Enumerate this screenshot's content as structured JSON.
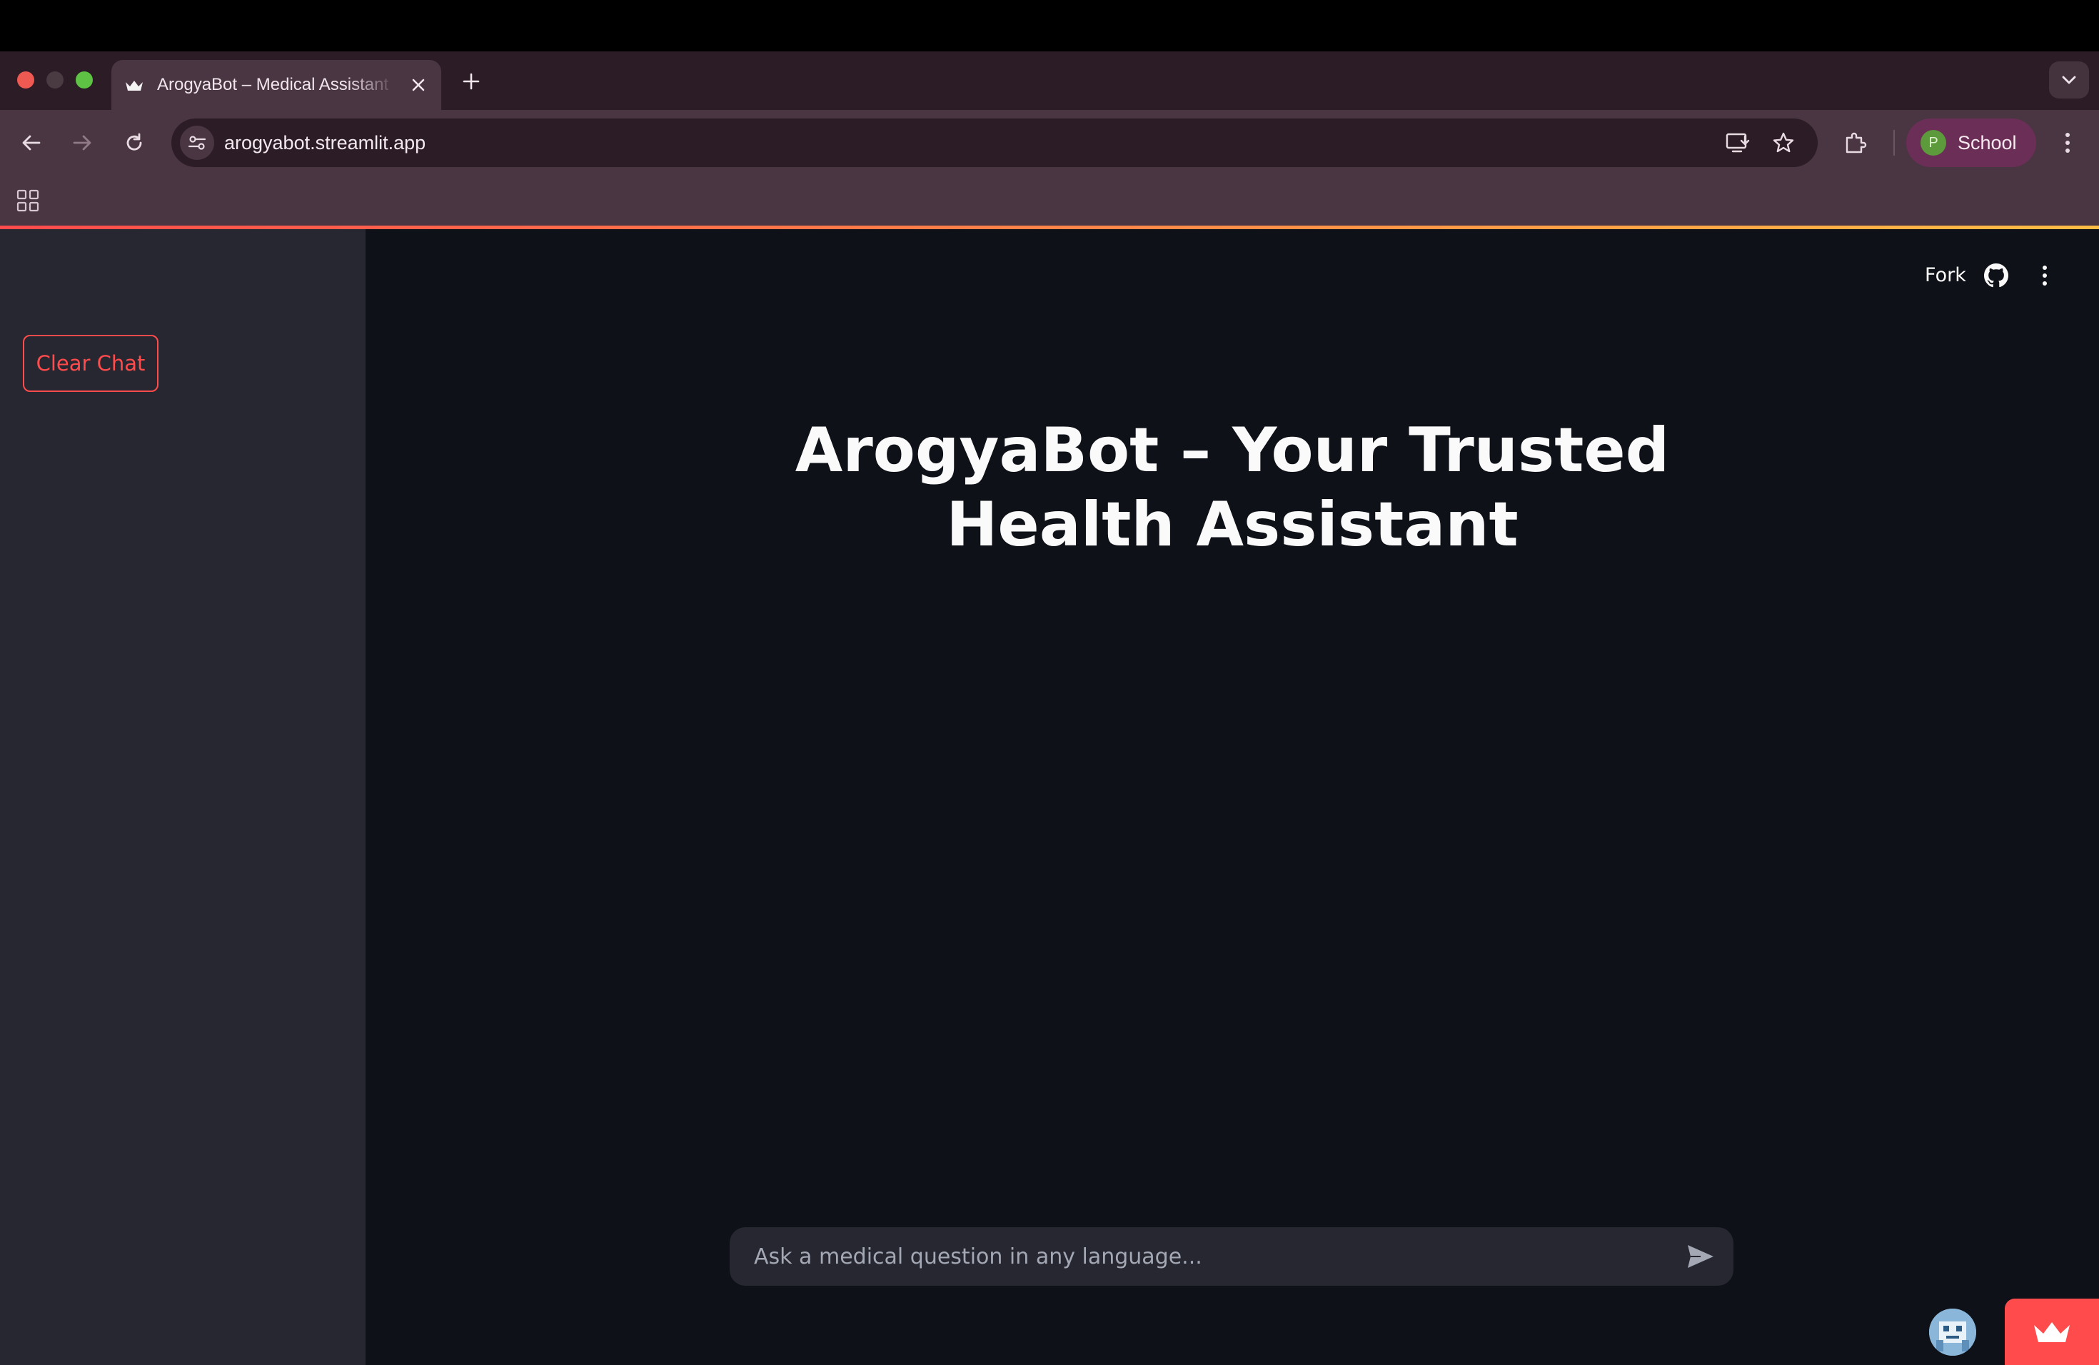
{
  "browser": {
    "tab": {
      "title": "ArogyaBot – Medical Assistant",
      "favicon": "crown-icon"
    },
    "url": "arogyabot.streamlit.app",
    "profile": {
      "initial": "P",
      "name": "School"
    }
  },
  "app": {
    "sidebar": {
      "clear_button_label": "Clear Chat"
    },
    "header": {
      "fork_label": "Fork"
    },
    "title": "ArogyaBot – Your Trusted Health Assistant",
    "chat_input": {
      "placeholder": "Ask a medical question in any language...",
      "value": ""
    }
  },
  "colors": {
    "accent": "#ff4b4b",
    "sidebar_bg": "#262730",
    "main_bg": "#0e1117",
    "browser_frame": "#4a3542"
  }
}
